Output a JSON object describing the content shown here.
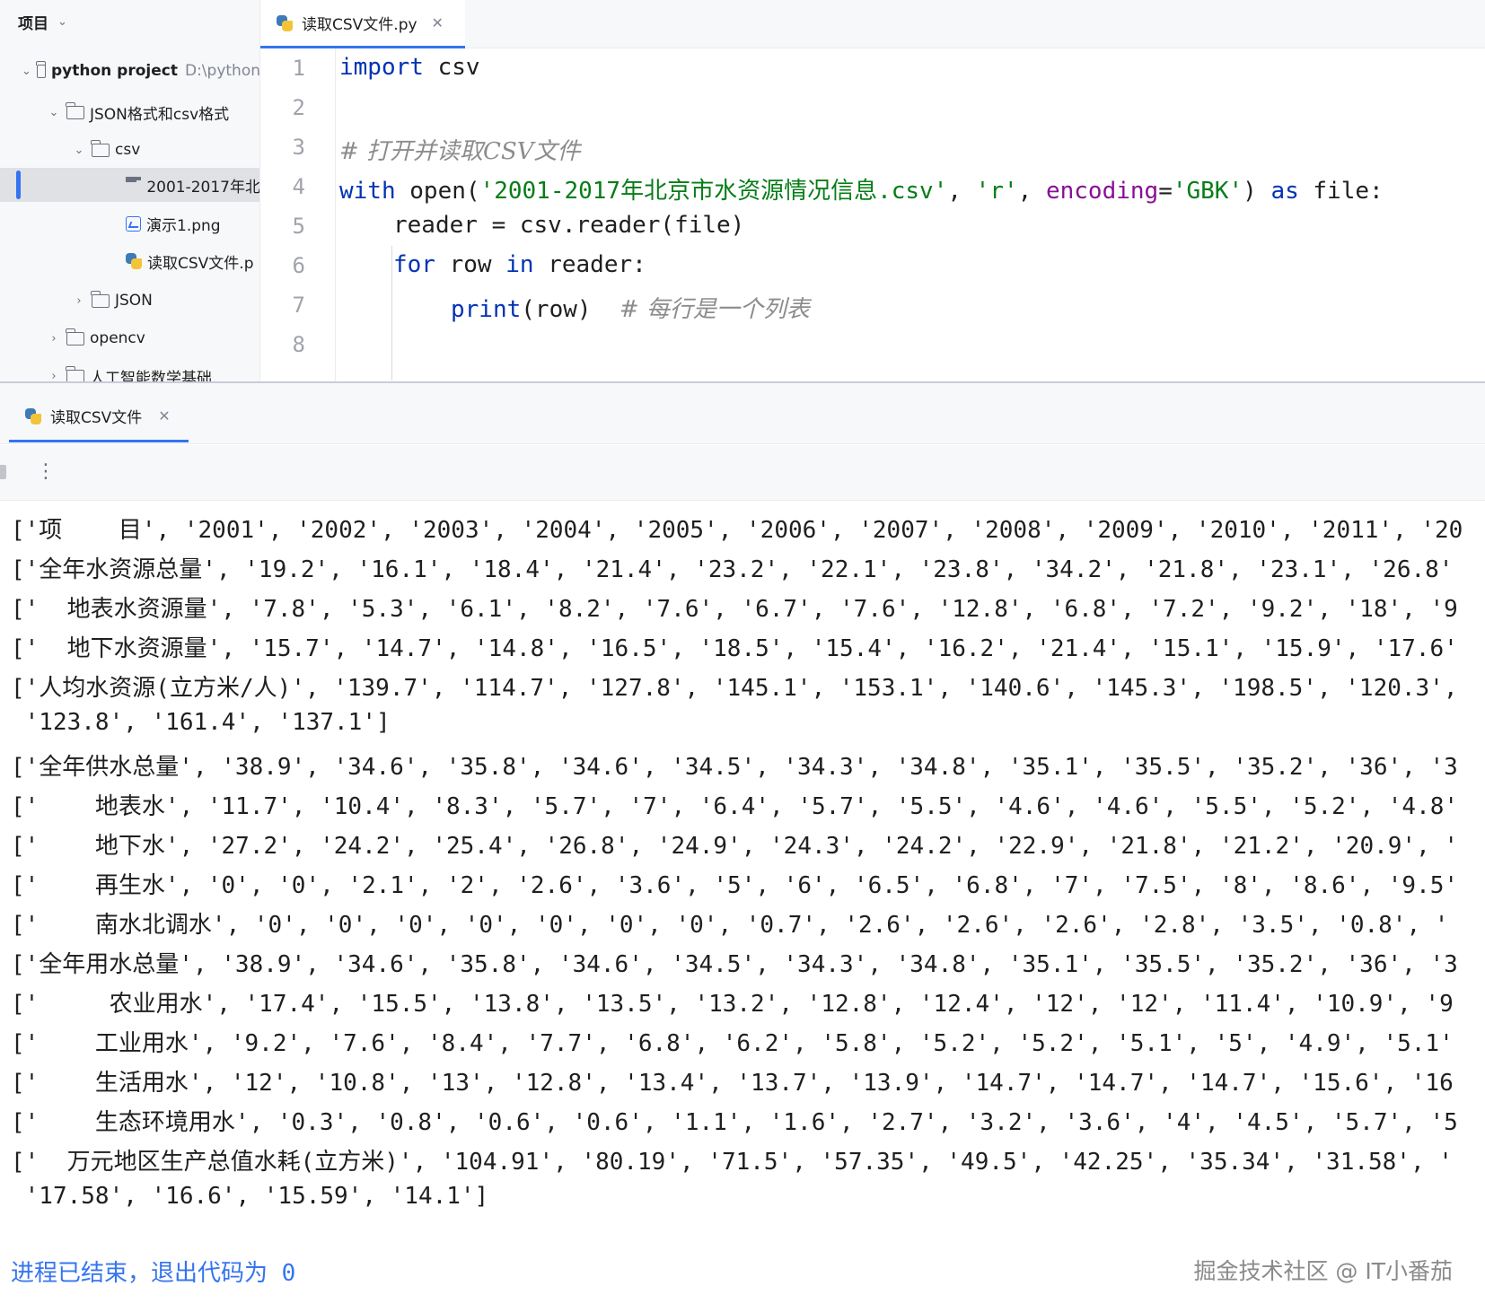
{
  "project_panel": {
    "header": "项目",
    "items": [
      {
        "label": "python project",
        "suffix": "D:\\python"
      },
      {
        "label": "JSON格式和csv格式"
      },
      {
        "label": "csv"
      },
      {
        "label": "2001-2017年北"
      },
      {
        "label": "演示1.png"
      },
      {
        "label": "读取CSV文件.p"
      },
      {
        "label": "JSON"
      },
      {
        "label": "opencv"
      },
      {
        "label": "人工智能数学基础"
      }
    ]
  },
  "editor": {
    "tab_label": "读取CSV文件.py",
    "line_numbers": [
      "1",
      "2",
      "3",
      "4",
      "5",
      "6",
      "7",
      "8"
    ],
    "code": {
      "l1_kw": "import",
      "l1_rest": " csv",
      "l3_comment": "# 打开并读取CSV文件",
      "l4_with": "with",
      "l4_open": " open(",
      "l4_str1": "'2001-2017年北京市水资源情况信息.csv'",
      "l4_comma1": ", ",
      "l4_str2": "'r'",
      "l4_comma2": ", ",
      "l4_param": "encoding",
      "l4_eq": "=",
      "l4_str3": "'GBK'",
      "l4_close": ") ",
      "l4_as": "as",
      "l4_file": " file:",
      "l5": "reader = csv.reader(file)",
      "l6_for": "for",
      "l6_row": " row ",
      "l6_in": "in",
      "l6_rest": " reader:",
      "l7_print": "print",
      "l7_rest": "(row)  ",
      "l7_comment": "# 每行是一个列表"
    }
  },
  "run_panel": {
    "tab_label": "读取CSV文件",
    "more_icon": "⋮",
    "output_lines": [
      "['项    目', '2001', '2002', '2003', '2004', '2005', '2006', '2007', '2008', '2009', '2010', '2011', '20",
      "['全年水资源总量', '19.2', '16.1', '18.4', '21.4', '23.2', '22.1', '23.8', '34.2', '21.8', '23.1', '26.8'",
      "['  地表水资源量', '7.8', '5.3', '6.1', '8.2', '7.6', '6.7', '7.6', '12.8', '6.8', '7.2', '9.2', '18', '9",
      "['  地下水资源量', '15.7', '14.7', '14.8', '16.5', '18.5', '15.4', '16.2', '21.4', '15.1', '15.9', '17.6'",
      "['人均水资源(立方米/人)', '139.7', '114.7', '127.8', '145.1', '153.1', '140.6', '145.3', '198.5', '120.3',",
      " '123.8', '161.4', '137.1']",
      "['全年供水总量', '38.9', '34.6', '35.8', '34.6', '34.5', '34.3', '34.8', '35.1', '35.5', '35.2', '36', '3",
      "['    地表水', '11.7', '10.4', '8.3', '5.7', '7', '6.4', '5.7', '5.5', '4.6', '4.6', '5.5', '5.2', '4.8'",
      "['    地下水', '27.2', '24.2', '25.4', '26.8', '24.9', '24.3', '24.2', '22.9', '21.8', '21.2', '20.9', '",
      "['    再生水', '0', '0', '2.1', '2', '2.6', '3.6', '5', '6', '6.5', '6.8', '7', '7.5', '8', '8.6', '9.5'",
      "['    南水北调水', '0', '0', '0', '0', '0', '0', '0', '0.7', '2.6', '2.6', '2.6', '2.8', '3.5', '0.8', '",
      "['全年用水总量', '38.9', '34.6', '35.8', '34.6', '34.5', '34.3', '34.8', '35.1', '35.5', '35.2', '36', '3",
      "['     农业用水', '17.4', '15.5', '13.8', '13.5', '13.2', '12.8', '12.4', '12', '12', '11.4', '10.9', '9",
      "['    工业用水', '9.2', '7.6', '8.4', '7.7', '6.8', '6.2', '5.8', '5.2', '5.2', '5.1', '5', '4.9', '5.1'",
      "['    生活用水', '12', '10.8', '13', '12.8', '13.4', '13.7', '13.9', '14.7', '14.7', '14.7', '15.6', '16",
      "['    生态环境用水', '0.3', '0.8', '0.6', '0.6', '1.1', '1.6', '2.7', '3.2', '3.6', '4', '4.5', '5.7', '5",
      "['  万元地区生产总值水耗(立方米)', '104.91', '80.19', '71.5', '57.35', '49.5', '42.25', '35.34', '31.58', '",
      " '17.58', '16.6', '15.59', '14.1']"
    ],
    "exit_message": "进程已结束，退出代码为 0",
    "watermark": "掘金技术社区 @ IT小番茄"
  }
}
